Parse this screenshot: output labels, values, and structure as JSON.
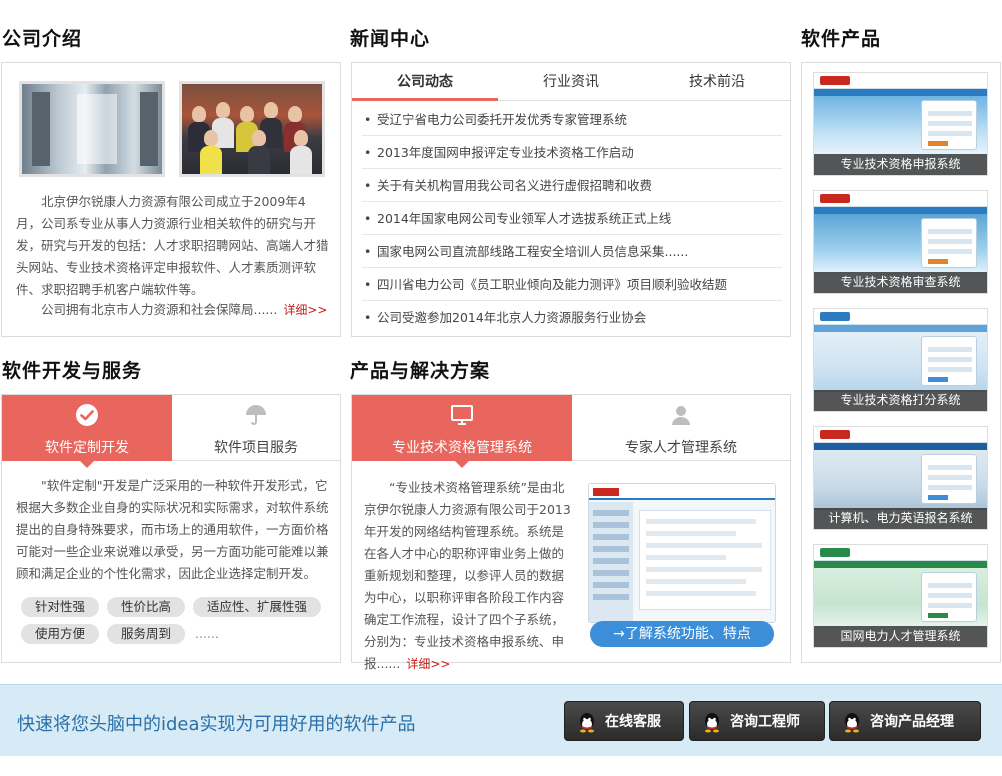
{
  "sections": {
    "about_title": "公司介绍",
    "news_title": "新闻中心",
    "products_title": "软件产品",
    "services_title": "软件开发与服务",
    "solutions_title": "产品与解决方案"
  },
  "about": {
    "paragraph1": "北京伊尔锐康人力资源有限公司成立于2009年4月，公司系专业从事人力资源行业相关软件的研究与开发，研究与开发的包括：人才求职招聘网站、高端人才猎头网站、专业技术资格评定申报软件、人才素质测评软件、求职招聘手机客户端软件等。",
    "paragraph2": "公司拥有北京市人力资源和社会保障局......",
    "more_label": "详细>>"
  },
  "news": {
    "tabs": [
      "公司动态",
      "行业资讯",
      "技术前沿"
    ],
    "active_tab": 0,
    "items": [
      "受辽宁省电力公司委托开发优秀专家管理系统",
      "2013年度国网申报评定专业技术资格工作启动",
      "关于有关机构冒用我公司名义进行虚假招聘和收费",
      "2014年国家电网公司专业领军人才选拔系统正式上线",
      "国家电网公司直流部线路工程安全培训人员信息采集......",
      "四川省电力公司《员工职业倾向及能力测评》项目顺利验收结题",
      "公司受邀参加2014年北京人力资源服务行业协会"
    ]
  },
  "products": [
    "专业技术资格申报系统",
    "专业技术资格审查系统",
    "专业技术资格打分系统",
    "计算机、电力英语报名系统",
    "国网电力人才管理系统"
  ],
  "services": {
    "tabs": [
      {
        "label": "软件定制开发",
        "icon": "check-circle-icon"
      },
      {
        "label": "软件项目服务",
        "icon": "umbrella-icon"
      }
    ],
    "active_tab": 0,
    "paragraph": "\"软件定制\"开发是广泛采用的一种软件开发形式，它根据大多数企业自身的实际状况和实际需求，对软件系统提出的自身特殊要求，而市场上的通用软件，一方面价格可能对一些企业来说难以承受，另一方面功能可能难以兼顾和满足企业的个性化需求，因此企业选择定制开发。",
    "tags": [
      "针对性强",
      "性价比高",
      "适应性、扩展性强",
      "使用方便",
      "服务周到"
    ],
    "tags_more": "......"
  },
  "solutions": {
    "tabs": [
      {
        "label": "专业技术资格管理系统",
        "icon": "monitor-icon"
      },
      {
        "label": "专家人才管理系统",
        "icon": "user-icon"
      }
    ],
    "active_tab": 0,
    "paragraph": "“专业技术资格管理系统”是由北京伊尔锐康人力资源有限公司于2013年开发的网络结构管理系统。系统是在各人才中心的职称评审业务上做的重新规划和整理，以参评人员的数据为中心，以职称评审各阶段工作内容确定工作流程，设计了四个子系统，分别为：专业技术资格申报系统、申报......",
    "more_label": "详细>>",
    "learn_more_label": "→了解系统功能、特点"
  },
  "cta": {
    "text": "快速将您头脑中的idea实现为可用好用的软件产品",
    "buttons": [
      "在线客服",
      "咨询工程师",
      "咨询产品经理"
    ]
  },
  "colors": {
    "accent": "#e8665e",
    "link_red": "#c81a1a",
    "button_blue": "#3d8ed8",
    "cta_bg": "#d6ebf5"
  }
}
